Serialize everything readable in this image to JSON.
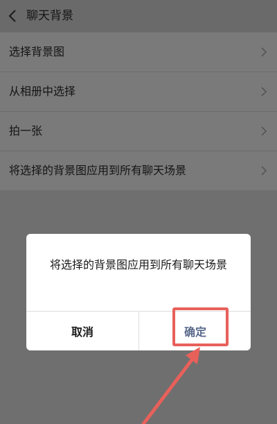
{
  "header": {
    "title": "聊天背景"
  },
  "menu": {
    "items": [
      {
        "label": "选择背景图"
      },
      {
        "label": "从相册中选择"
      },
      {
        "label": "拍一张"
      },
      {
        "label": "将选择的背景图应用到所有聊天场景"
      }
    ]
  },
  "dialog": {
    "message": "将选择的背景图应用到所有聊天场景",
    "cancel_label": "取消",
    "ok_label": "确定",
    "ok_color": "#5b6b8c"
  },
  "annotation": {
    "color": "#e8605a"
  }
}
